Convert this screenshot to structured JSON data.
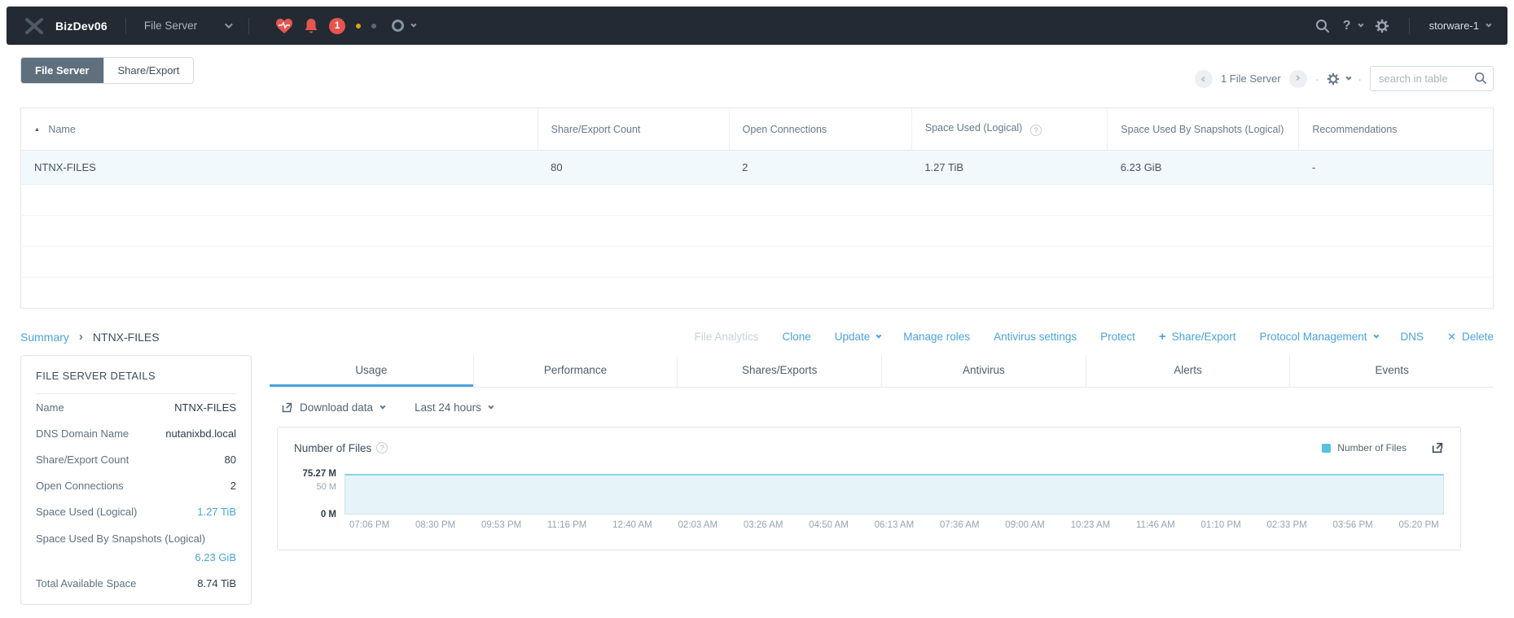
{
  "topbar": {
    "cluster_name": "BizDev06",
    "context_menu": "File Server",
    "alert_count": "1",
    "help_label": "?",
    "user_name": "storware-1"
  },
  "view_tabs": [
    {
      "label": "File Server",
      "active": true
    },
    {
      "label": "Share/Export",
      "active": false
    }
  ],
  "toolbar": {
    "count_label": "1 File Server",
    "search_placeholder": "search in table"
  },
  "table": {
    "columns": [
      "Name",
      "Share/Export Count",
      "Open Connections",
      "Space Used (Logical)",
      "Space Used By Snapshots (Logical)",
      "Recommendations"
    ],
    "rows": [
      [
        "NTNX-FILES",
        "80",
        "2",
        "1.27 TiB",
        "6.23 GiB",
        "-"
      ]
    ]
  },
  "breadcrumb": {
    "parent": "Summary",
    "separator": "›",
    "current": "NTNX-FILES"
  },
  "actions": [
    {
      "label": "File Analytics",
      "disabled": true
    },
    {
      "label": "Clone"
    },
    {
      "label": "Update",
      "has_dropdown": true
    },
    {
      "label": "Manage roles"
    },
    {
      "label": "Antivirus settings"
    },
    {
      "label": "Protect"
    },
    {
      "label": "Share/Export",
      "icon": "plus"
    },
    {
      "label": "Protocol Management",
      "has_dropdown": true
    },
    {
      "label": "DNS"
    },
    {
      "label": "Delete",
      "icon": "x"
    }
  ],
  "details": {
    "title": "FILE SERVER DETAILS",
    "items": [
      {
        "label": "Name",
        "value": "NTNX-FILES"
      },
      {
        "label": "DNS Domain Name",
        "value": "nutanixbd.local"
      },
      {
        "label": "Share/Export Count",
        "value": "80"
      },
      {
        "label": "Open Connections",
        "value": "2"
      },
      {
        "label": "Space Used (Logical)",
        "value": "1.27 TiB",
        "link": true
      },
      {
        "label": "Space Used By Snapshots (Logical)",
        "value": "6.23 GiB",
        "link": true
      },
      {
        "label": "Total Available Space",
        "value": "8.74 TiB"
      }
    ]
  },
  "detail_tabs": [
    {
      "label": "Usage",
      "active": true
    },
    {
      "label": "Performance"
    },
    {
      "label": "Shares/Exports"
    },
    {
      "label": "Antivirus"
    },
    {
      "label": "Alerts"
    },
    {
      "label": "Events"
    }
  ],
  "controls": {
    "download_label": "Download data",
    "time_range": "Last 24 hours"
  },
  "chart_data": {
    "type": "area",
    "title": "Number of Files",
    "legend": [
      {
        "name": "Number of Files",
        "color": "#57C1DF"
      }
    ],
    "legend_position": "top-right",
    "grid": false,
    "x": [
      "07:06 PM",
      "08:30 PM",
      "09:53 PM",
      "11:16 PM",
      "12:40 AM",
      "02:03 AM",
      "03:26 AM",
      "04:50 AM",
      "06:13 AM",
      "07:36 AM",
      "09:00 AM",
      "10:23 AM",
      "11:46 AM",
      "01:10 PM",
      "02:33 PM",
      "03:56 PM",
      "05:20 PM"
    ],
    "series": [
      {
        "name": "Number of Files",
        "values": [
          75.27,
          75.27,
          75.27,
          75.27,
          75.27,
          75.27,
          75.27,
          75.27,
          75.27,
          75.27,
          75.27,
          75.27,
          75.27,
          75.27,
          75.27,
          75.27,
          75.27
        ]
      }
    ],
    "yticks": [
      "75.27 M",
      "50 M",
      "0 M"
    ],
    "ylim": [
      0,
      75.27
    ],
    "unit": "M",
    "xlabel": "",
    "ylabel": ""
  },
  "icons": {
    "middot": "·",
    "sort_asc": "▲",
    "help_q": "?",
    "plus": "+",
    "x": "✕"
  },
  "colors": {
    "accent_blue": "#4AA3DF",
    "topbar_bg": "#232A33",
    "alert_red": "#E8544D",
    "legend_cyan": "#57C1DF",
    "chart_fill": "#E6F4FA",
    "chart_line": "#8AD2E8",
    "active_view_tab_bg": "#5F6F7E",
    "selected_row_bg": "#F2F9FD"
  }
}
